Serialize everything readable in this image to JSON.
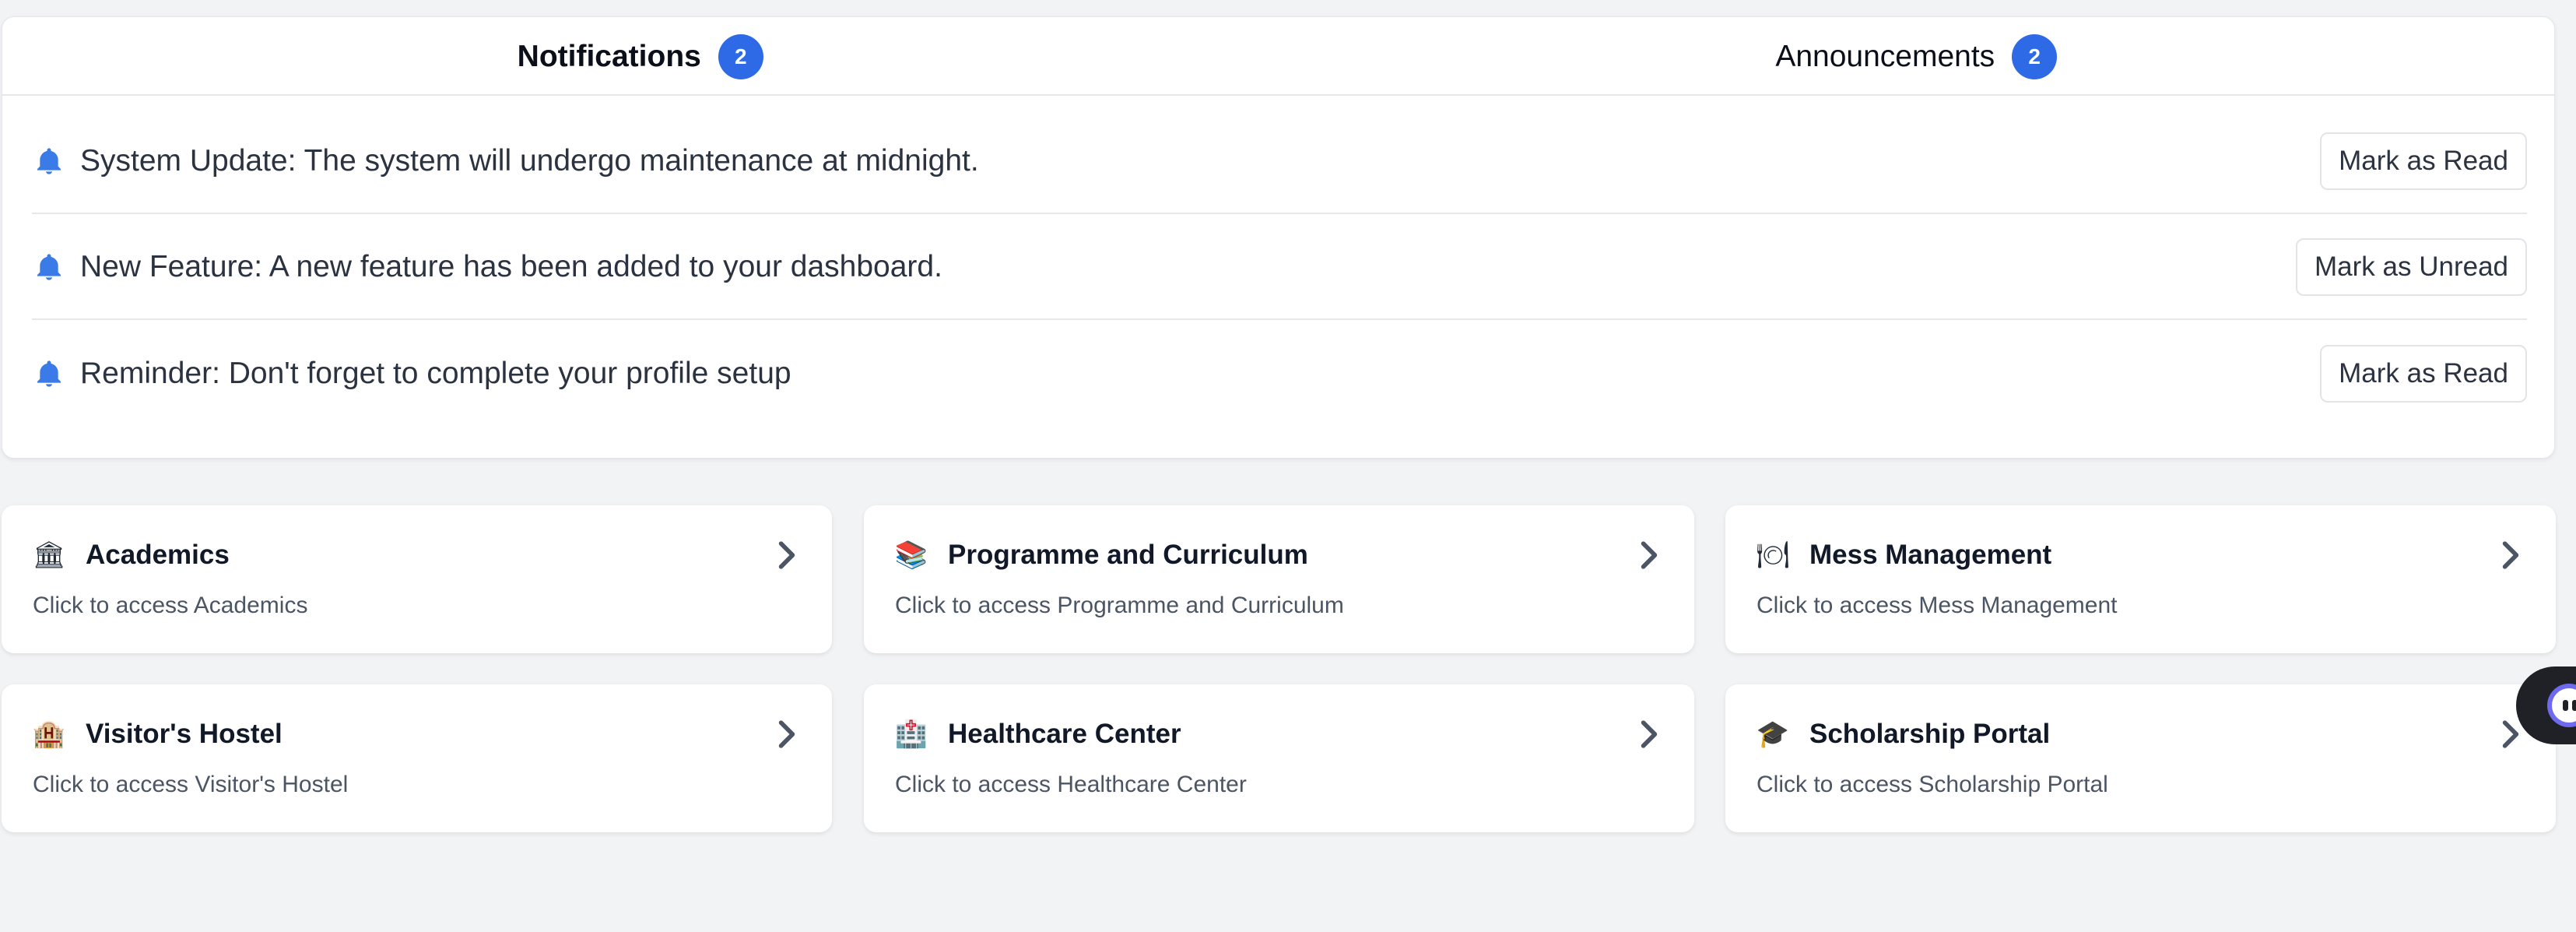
{
  "tabs": [
    {
      "label": "Notifications",
      "count": "2",
      "active": true
    },
    {
      "label": "Announcements",
      "count": "2",
      "active": false
    }
  ],
  "notifications": [
    {
      "text": "System Update: The system will undergo maintenance at midnight.",
      "action": "Mark as Read",
      "icon": "bell-icon"
    },
    {
      "text": "New Feature: A new feature has been added to your dashboard.",
      "action": "Mark as Unread",
      "icon": "bell-icon"
    },
    {
      "text": "Reminder: Don't forget to complete your profile setup",
      "action": "Mark as Read",
      "icon": "bell-icon"
    }
  ],
  "modules": [
    {
      "title": "Academics",
      "subtitle": "Click to access Academics",
      "icon": "classical-building-icon",
      "glyph": "🏛"
    },
    {
      "title": "Programme and Curriculum",
      "subtitle": "Click to access Programme and Curriculum",
      "icon": "books-icon",
      "glyph": "📚"
    },
    {
      "title": "Mess Management",
      "subtitle": "Click to access Mess Management",
      "icon": "plate-cutlery-icon",
      "glyph": "🍽"
    },
    {
      "title": "Visitor's Hostel",
      "subtitle": "Click to access Visitor's Hostel",
      "icon": "hotel-icon",
      "glyph": "🏨"
    },
    {
      "title": "Healthcare Center",
      "subtitle": "Click to access Healthcare Center",
      "icon": "medical-building-icon",
      "glyph": "🏥"
    },
    {
      "title": "Scholarship Portal",
      "subtitle": "Click to access Scholarship Portal",
      "icon": "graduation-cap-icon",
      "glyph": "🎓"
    }
  ],
  "colors": {
    "accent": "#2f6ae6",
    "background": "#f2f3f5",
    "card": "#ffffff"
  }
}
